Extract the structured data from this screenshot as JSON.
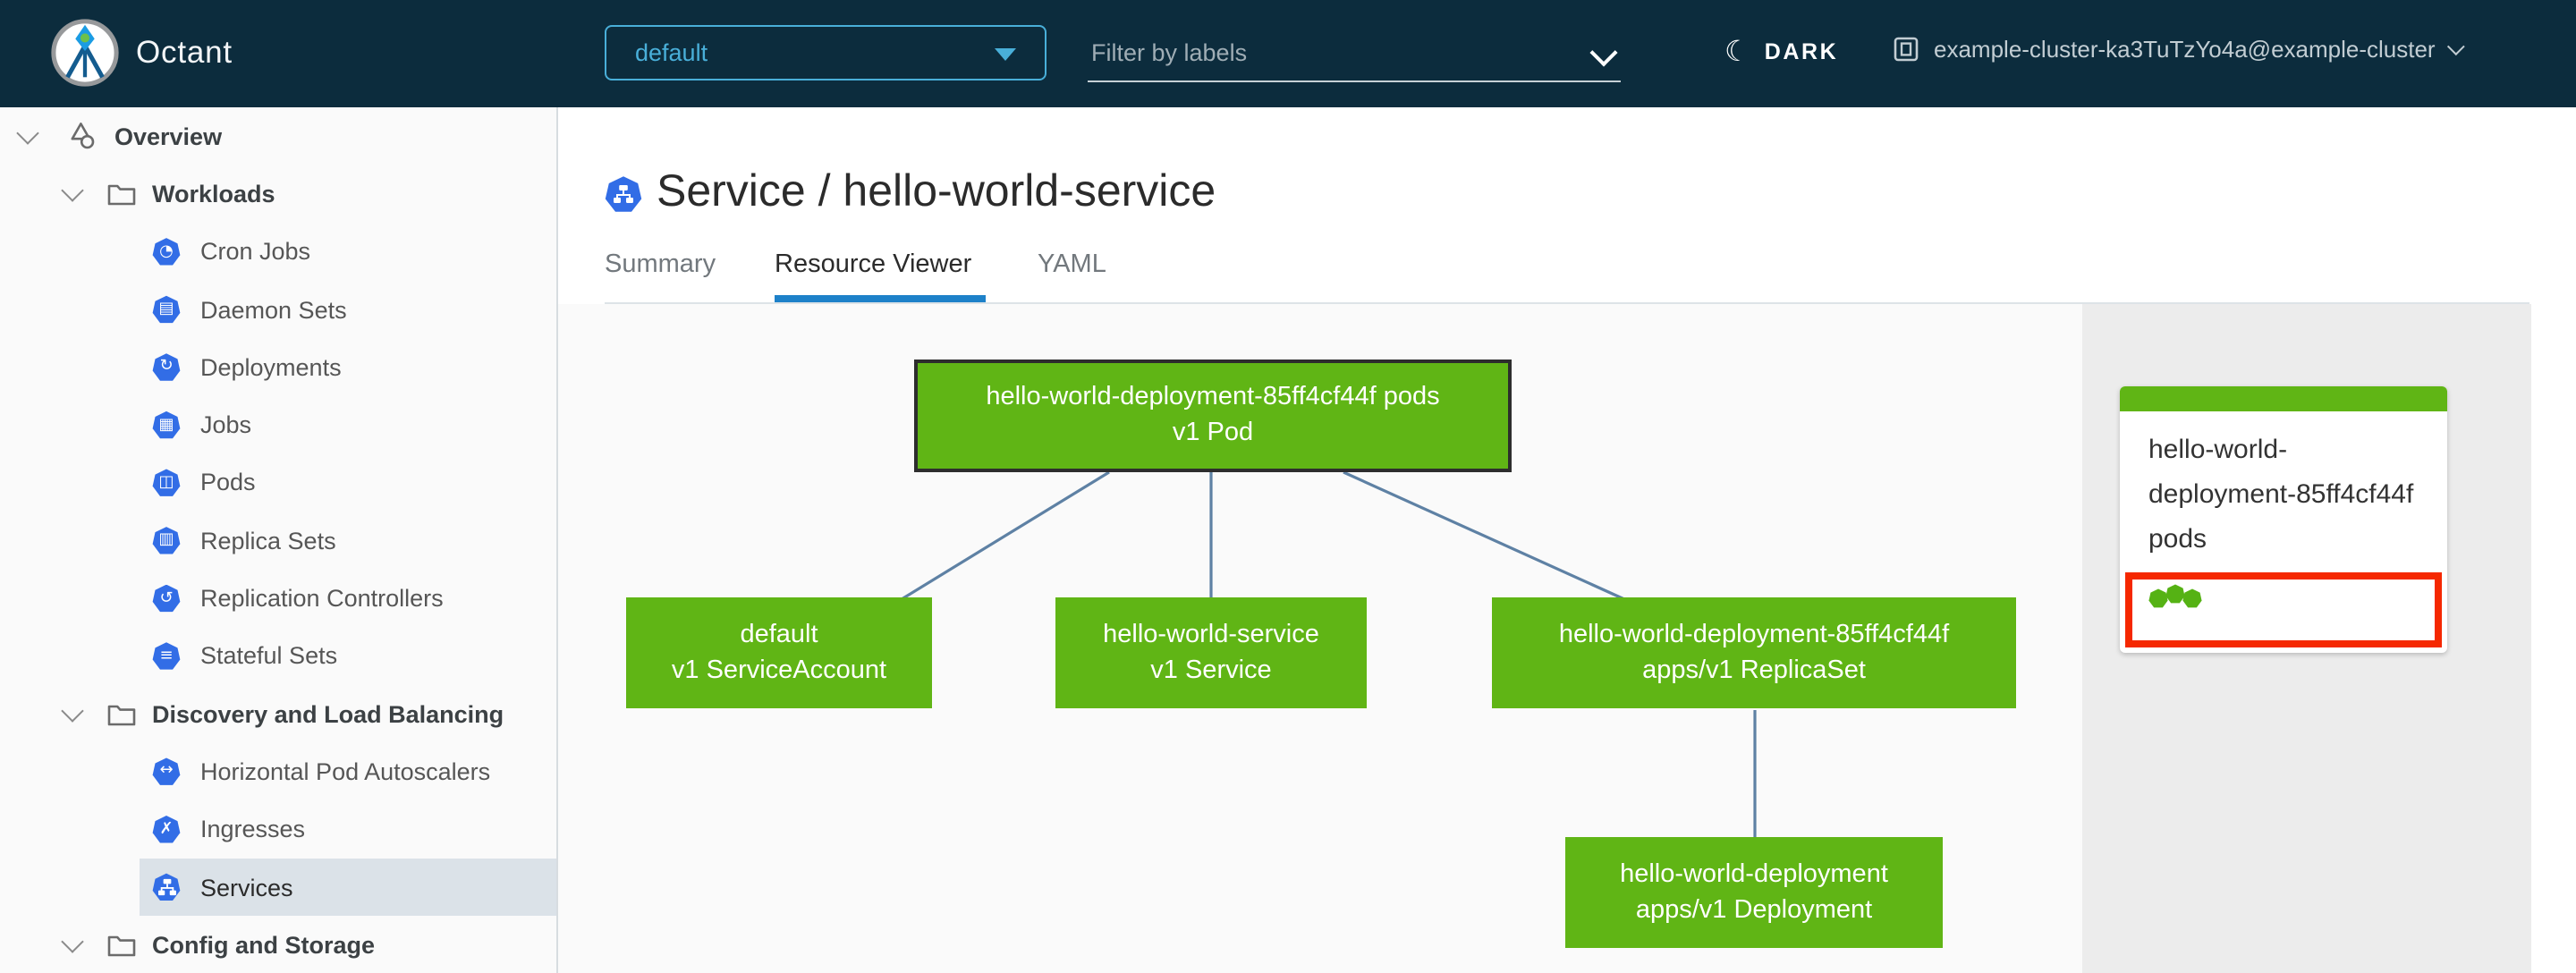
{
  "header": {
    "app_name": "Octant",
    "namespace_value": "default",
    "filter_placeholder": "Filter by labels",
    "theme_label": "DARK",
    "context_label": "example-cluster-ka3TuTzYo4a@example-cluster"
  },
  "sidebar": {
    "items": [
      {
        "label": "Overview",
        "icon": "applications-icon",
        "expanded": true
      },
      {
        "label": "Workloads",
        "icon": "folder-icon",
        "expanded": true
      },
      {
        "label": "Cron Jobs",
        "icon": "cron-jobs-icon",
        "glyph": "◔"
      },
      {
        "label": "Daemon Sets",
        "icon": "daemon-sets-icon",
        "glyph": "▤"
      },
      {
        "label": "Deployments",
        "icon": "deployments-icon",
        "glyph": "↻"
      },
      {
        "label": "Jobs",
        "icon": "jobs-icon",
        "glyph": "▦"
      },
      {
        "label": "Pods",
        "icon": "pods-icon",
        "glyph": "◫"
      },
      {
        "label": "Replica Sets",
        "icon": "replica-sets-icon",
        "glyph": "▥"
      },
      {
        "label": "Replication Controllers",
        "icon": "replication-controllers-icon",
        "glyph": "↺"
      },
      {
        "label": "Stateful Sets",
        "icon": "stateful-sets-icon",
        "glyph": "≡"
      },
      {
        "label": "Discovery and Load Balancing",
        "icon": "folder-icon",
        "expanded": true
      },
      {
        "label": "Horizontal Pod Autoscalers",
        "icon": "horizontal-pod-autoscalers-icon",
        "glyph": "↔"
      },
      {
        "label": "Ingresses",
        "icon": "ingresses-icon",
        "glyph": "✗"
      },
      {
        "label": "Services",
        "icon": "services-icon",
        "selected": true
      },
      {
        "label": "Config and Storage",
        "icon": "folder-icon",
        "expanded": true
      }
    ]
  },
  "main": {
    "title": "Service / hello-world-service",
    "tabs": [
      {
        "label": "Summary",
        "active": false
      },
      {
        "label": "Resource Viewer",
        "active": true
      },
      {
        "label": "YAML",
        "active": false
      }
    ]
  },
  "graph": {
    "nodes": [
      {
        "id": "pod",
        "line1": "hello-world-deployment-85ff4cf44f pods",
        "line2": "v1 Pod",
        "selected": true
      },
      {
        "id": "serviceaccount",
        "line1": "default",
        "line2": "v1 ServiceAccount",
        "selected": false
      },
      {
        "id": "service",
        "line1": "hello-world-service",
        "line2": "v1 Service",
        "selected": false
      },
      {
        "id": "replicaset",
        "line1": "hello-world-deployment-85ff4cf44f",
        "line2": "apps/v1 ReplicaSet",
        "selected": false
      },
      {
        "id": "deployment",
        "line1": "hello-world-deployment",
        "line2": "apps/v1 Deployment",
        "selected": false
      }
    ],
    "edges": [
      {
        "from": "pod",
        "to": "serviceaccount"
      },
      {
        "from": "pod",
        "to": "service"
      },
      {
        "from": "pod",
        "to": "replicaset"
      },
      {
        "from": "replicaset",
        "to": "deployment"
      }
    ]
  },
  "side_panel": {
    "card": {
      "title": "hello-world-deployment-85ff4cf44f pods",
      "status_dots": 3
    }
  },
  "colors": {
    "header_bg": "#0c2c3d",
    "accent_blue": "#49afd9",
    "k8s_blue": "#326de6",
    "node_green": "#60b515",
    "selection_red": "#f52800",
    "edge_blue": "#5e81a4",
    "tab_underline": "#1d81c9",
    "sidebar_selected_bg": "#dbe2e8"
  }
}
